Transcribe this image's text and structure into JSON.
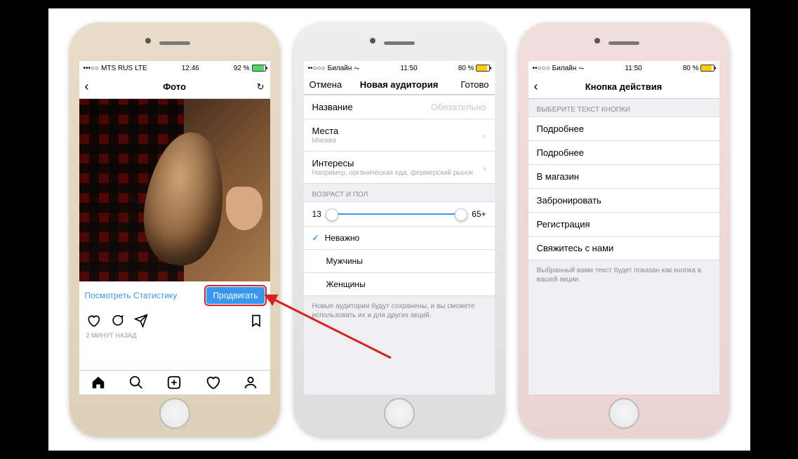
{
  "phone1": {
    "status": {
      "carrier": "MTS RUS",
      "net": "LTE",
      "time": "12:46",
      "battery": "92 %"
    },
    "nav": {
      "title": "Фото"
    },
    "actions": {
      "stats": "Посмотреть Статистику",
      "promote": "Продвигать"
    },
    "time_ago": "2 МИНУТ НАЗАД"
  },
  "phone2": {
    "status": {
      "carrier": "Билайн",
      "time": "11:50",
      "battery": "80 %"
    },
    "nav": {
      "cancel": "Отмена",
      "title": "Новая аудитория",
      "done": "Готово"
    },
    "fields": {
      "name_label": "Название",
      "name_hint": "Обязательно",
      "places_label": "Места",
      "places_sub": "Москва",
      "interests_label": "Интересы",
      "interests_sub": "Например, органическая еда, фермерский рынок"
    },
    "section_age": "ВОЗРАСТ И ПОЛ",
    "age_min": "13",
    "age_max": "65+",
    "gender": {
      "any": "Неважно",
      "male": "Мужчины",
      "female": "Женщины"
    },
    "footer": "Новые аудитории будут сохранены, и вы сможете использовать их и для других акций."
  },
  "phone3": {
    "status": {
      "carrier": "Билайн",
      "time": "11:50",
      "battery": "80 %"
    },
    "nav": {
      "title": "Кнопка действия"
    },
    "section": "ВЫБЕРИТЕ ТЕКСТ КНОПКИ",
    "options": [
      "Подробнее",
      "Подробнее",
      "В магазин",
      "Забронировать",
      "Регистрация",
      "Свяжитесь с нами"
    ],
    "footer": "Выбранный вами текст будет показан как кнопка в вашей акции."
  }
}
